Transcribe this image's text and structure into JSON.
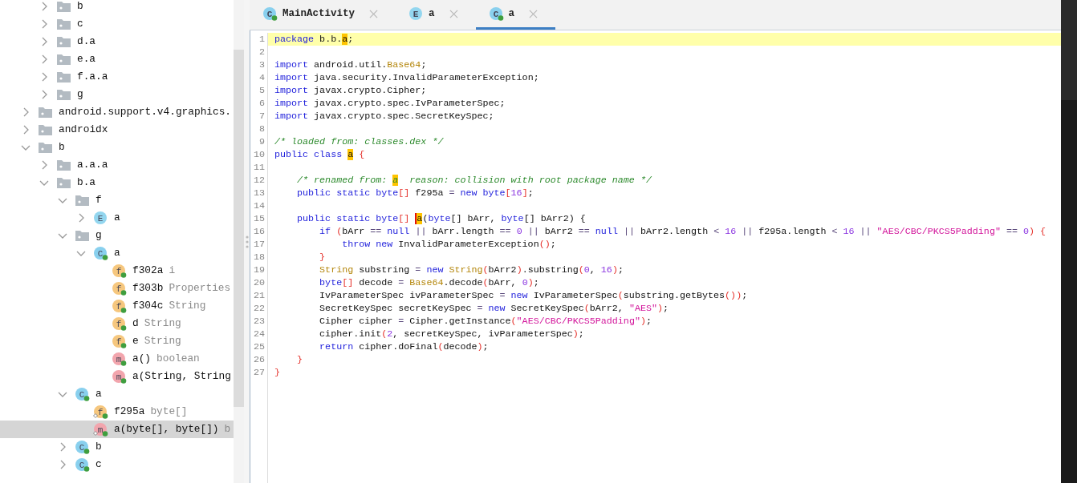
{
  "tree": [
    {
      "children": [
        {
          "label": "b",
          "kind": "package",
          "expanded": false,
          "selected": false
        },
        {
          "label": "c",
          "kind": "package",
          "expanded": false,
          "selected": false
        },
        {
          "label": "d.a",
          "kind": "package",
          "expanded": false,
          "selected": false
        },
        {
          "label": "e.a",
          "kind": "package",
          "expanded": false,
          "selected": false
        },
        {
          "label": "f.a.a",
          "kind": "package",
          "expanded": false,
          "selected": false
        },
        {
          "label": "g",
          "kind": "package",
          "expanded": false,
          "selected": false
        }
      ]
    },
    {
      "label": "android.support.v4.graphics.",
      "kind": "package",
      "expanded": false,
      "selected": false
    },
    {
      "label": "androidx",
      "kind": "package",
      "expanded": false,
      "selected": false
    },
    {
      "label": "b",
      "kind": "package",
      "expanded": true,
      "selected": false,
      "children": [
        {
          "label": "a.a.a",
          "kind": "package",
          "expanded": false,
          "selected": false
        },
        {
          "label": "b.a",
          "kind": "package",
          "expanded": true,
          "selected": false,
          "children": [
            {
              "label": "f",
              "kind": "package",
              "expanded": true,
              "selected": false,
              "children": [
                {
                  "label": "a",
                  "kind": "enum",
                  "icon": "E",
                  "public": false,
                  "expanded": false,
                  "selected": false
                }
              ]
            },
            {
              "label": "g",
              "kind": "package",
              "expanded": true,
              "selected": false,
              "children": [
                {
                  "label": "a",
                  "kind": "class",
                  "icon": "C",
                  "public": true,
                  "expanded": true,
                  "selected": false,
                  "children": [
                    {
                      "label": "f302a",
                      "detail": "i",
                      "kind": "field",
                      "icon": "f",
                      "public": true,
                      "static": false,
                      "selected": false
                    },
                    {
                      "label": "f303b",
                      "detail": "Properties",
                      "kind": "field",
                      "icon": "f",
                      "public": true,
                      "static": false,
                      "selected": false
                    },
                    {
                      "label": "f304c",
                      "detail": "String",
                      "kind": "field",
                      "icon": "f",
                      "public": true,
                      "static": false,
                      "selected": false
                    },
                    {
                      "label": "d",
                      "detail": "String",
                      "kind": "field",
                      "icon": "f",
                      "public": true,
                      "static": false,
                      "selected": false
                    },
                    {
                      "label": "e",
                      "detail": "String",
                      "kind": "field",
                      "icon": "f",
                      "public": true,
                      "static": false,
                      "selected": false
                    },
                    {
                      "label": "a()",
                      "detail": "boolean",
                      "kind": "method",
                      "icon": "m",
                      "public": true,
                      "static": false,
                      "selected": false
                    },
                    {
                      "label": "a(String, String",
                      "kind": "method",
                      "icon": "m",
                      "public": true,
                      "static": false,
                      "selected": false
                    }
                  ]
                }
              ]
            },
            {
              "label": "a",
              "kind": "class",
              "icon": "C",
              "public": true,
              "expanded": true,
              "selected": false,
              "children": [
                {
                  "label": "f295a",
                  "detail": "byte[]",
                  "kind": "field",
                  "icon": "f",
                  "public": true,
                  "static": true,
                  "selected": false
                },
                {
                  "label": "a(byte[], byte[])",
                  "detail": "b",
                  "kind": "method",
                  "icon": "m",
                  "public": true,
                  "static": true,
                  "selected": true
                }
              ]
            },
            {
              "label": "b",
              "kind": "class",
              "icon": "C",
              "public": true,
              "expanded": false,
              "selected": false
            },
            {
              "label": "c",
              "kind": "class",
              "icon": "C",
              "public": true,
              "expanded": false,
              "selected": false
            }
          ]
        }
      ]
    }
  ],
  "tabs": [
    {
      "label": "MainActivity",
      "icon": "C",
      "kind": "class",
      "public": true,
      "selected": false
    },
    {
      "label": "a",
      "icon": "E",
      "kind": "enum",
      "public": false,
      "selected": false
    },
    {
      "label": "a",
      "icon": "C",
      "kind": "class",
      "public": true,
      "selected": true
    }
  ],
  "code": [
    {
      "number": "1",
      "highlighted": true,
      "tokens": [
        {
          "kind": "kw",
          "text": "package"
        },
        {
          "kind": "plain",
          "text": " b.b."
        },
        {
          "kind": "match",
          "text": "a"
        },
        {
          "kind": "plain",
          "text": ";"
        }
      ]
    },
    {
      "number": "2",
      "highlighted": false
    },
    {
      "number": "3",
      "highlighted": false,
      "tokens": [
        {
          "kind": "kw",
          "text": "import"
        },
        {
          "kind": "plain",
          "text": " android.util."
        },
        {
          "kind": "type",
          "text": "Base64"
        },
        {
          "kind": "plain",
          "text": ";"
        }
      ]
    },
    {
      "number": "4",
      "highlighted": false,
      "tokens": [
        {
          "kind": "kw",
          "text": "import"
        },
        {
          "kind": "plain",
          "text": " java.security.InvalidParameterException;"
        }
      ]
    },
    {
      "number": "5",
      "highlighted": false,
      "tokens": [
        {
          "kind": "kw",
          "text": "import"
        },
        {
          "kind": "plain",
          "text": " javax.crypto.Cipher;"
        }
      ]
    },
    {
      "number": "6",
      "highlighted": false,
      "tokens": [
        {
          "kind": "kw",
          "text": "import"
        },
        {
          "kind": "plain",
          "text": " javax.crypto.spec.IvParameterSpec;"
        }
      ]
    },
    {
      "number": "7",
      "highlighted": false,
      "tokens": [
        {
          "kind": "kw",
          "text": "import"
        },
        {
          "kind": "plain",
          "text": " javax.crypto.spec.SecretKeySpec;"
        }
      ]
    },
    {
      "number": "8",
      "highlighted": false
    },
    {
      "number": "9",
      "highlighted": false,
      "tokens": [
        {
          "kind": "comment",
          "text": "/* loaded from: classes.dex */"
        }
      ]
    },
    {
      "number": "10",
      "highlighted": false,
      "tokens": [
        {
          "kind": "kw",
          "text": "public class "
        },
        {
          "kind": "match",
          "text": "a"
        },
        {
          "kind": "paren",
          "text": " {"
        }
      ]
    },
    {
      "number": "11",
      "highlighted": false
    },
    {
      "number": "12",
      "highlighted": false,
      "tokens": [
        {
          "kind": "comment",
          "text": "    /* renamed from: "
        },
        {
          "kind": "comment-match",
          "text": "a"
        },
        {
          "kind": "comment",
          "text": "  reason: collision with root package name */"
        }
      ]
    },
    {
      "number": "13",
      "highlighted": false,
      "tokens": [
        {
          "kind": "kw",
          "text": "    public static byte"
        },
        {
          "kind": "paren",
          "text": "[]"
        },
        {
          "kind": "plain",
          "text": " f295a "
        },
        {
          "kind": "op",
          "text": "="
        },
        {
          "kind": "kw",
          "text": " new byte"
        },
        {
          "kind": "paren",
          "text": "["
        },
        {
          "kind": "num",
          "text": "16"
        },
        {
          "kind": "paren",
          "text": "]"
        },
        {
          "kind": "plain",
          "text": ";"
        }
      ]
    },
    {
      "number": "14",
      "highlighted": false
    },
    {
      "number": "15",
      "highlighted": false,
      "tokens": [
        {
          "kind": "kw",
          "text": "    public static byte"
        },
        {
          "kind": "paren",
          "text": "[] "
        },
        {
          "kind": "caret-match",
          "text": "a"
        },
        {
          "kind": "plain",
          "text": "("
        },
        {
          "kind": "kw",
          "text": "byte"
        },
        {
          "kind": "plain",
          "text": "[] bArr, "
        },
        {
          "kind": "kw",
          "text": "byte"
        },
        {
          "kind": "plain",
          "text": "[] bArr2) {"
        }
      ]
    },
    {
      "number": "16",
      "highlighted": false,
      "tokens": [
        {
          "kind": "kw",
          "text": "        if "
        },
        {
          "kind": "paren",
          "text": "("
        },
        {
          "kind": "plain",
          "text": "bArr "
        },
        {
          "kind": "op",
          "text": "=="
        },
        {
          "kind": "kw",
          "text": " null "
        },
        {
          "kind": "op",
          "text": "||"
        },
        {
          "kind": "plain",
          "text": " bArr.length "
        },
        {
          "kind": "op",
          "text": "=="
        },
        {
          "kind": "num",
          "text": " 0 "
        },
        {
          "kind": "op",
          "text": "||"
        },
        {
          "kind": "plain",
          "text": " bArr2 "
        },
        {
          "kind": "op",
          "text": "=="
        },
        {
          "kind": "kw",
          "text": " null "
        },
        {
          "kind": "op",
          "text": "||"
        },
        {
          "kind": "plain",
          "text": " bArr2.length "
        },
        {
          "kind": "op",
          "text": "<"
        },
        {
          "kind": "num",
          "text": " 16 "
        },
        {
          "kind": "op",
          "text": "||"
        },
        {
          "kind": "plain",
          "text": " f295a.length "
        },
        {
          "kind": "op",
          "text": "<"
        },
        {
          "kind": "num",
          "text": " 16 "
        },
        {
          "kind": "op",
          "text": "||"
        },
        {
          "kind": "str",
          "text": " \"AES/CBC/PKCS5Padding\" "
        },
        {
          "kind": "op",
          "text": "=="
        },
        {
          "kind": "num",
          "text": " 0"
        },
        {
          "kind": "paren",
          "text": ") {"
        }
      ]
    },
    {
      "number": "17",
      "highlighted": false,
      "tokens": [
        {
          "kind": "kw",
          "text": "            throw new"
        },
        {
          "kind": "plain",
          "text": " InvalidParameterException"
        },
        {
          "kind": "paren",
          "text": "()"
        },
        {
          "kind": "plain",
          "text": ";"
        }
      ]
    },
    {
      "number": "18",
      "highlighted": false,
      "tokens": [
        {
          "kind": "paren",
          "text": "        }"
        }
      ]
    },
    {
      "number": "19",
      "highlighted": false,
      "tokens": [
        {
          "kind": "type",
          "text": "        String"
        },
        {
          "kind": "plain",
          "text": " substring "
        },
        {
          "kind": "op",
          "text": "="
        },
        {
          "kind": "kw",
          "text": " new "
        },
        {
          "kind": "type",
          "text": "String"
        },
        {
          "kind": "paren",
          "text": "("
        },
        {
          "kind": "plain",
          "text": "bArr2"
        },
        {
          "kind": "paren",
          "text": ")"
        },
        {
          "kind": "plain",
          "text": ".substring"
        },
        {
          "kind": "paren",
          "text": "("
        },
        {
          "kind": "num",
          "text": "0"
        },
        {
          "kind": "plain",
          "text": ", "
        },
        {
          "kind": "num",
          "text": "16"
        },
        {
          "kind": "paren",
          "text": ")"
        },
        {
          "kind": "plain",
          "text": ";"
        }
      ]
    },
    {
      "number": "20",
      "highlighted": false,
      "tokens": [
        {
          "kind": "kw",
          "text": "        byte"
        },
        {
          "kind": "paren",
          "text": "[]"
        },
        {
          "kind": "plain",
          "text": " decode "
        },
        {
          "kind": "op",
          "text": "="
        },
        {
          "kind": "type",
          "text": " Base64"
        },
        {
          "kind": "plain",
          "text": ".decode"
        },
        {
          "kind": "paren",
          "text": "("
        },
        {
          "kind": "plain",
          "text": "bArr, "
        },
        {
          "kind": "num",
          "text": "0"
        },
        {
          "kind": "paren",
          "text": ")"
        },
        {
          "kind": "plain",
          "text": ";"
        }
      ]
    },
    {
      "number": "21",
      "highlighted": false,
      "tokens": [
        {
          "kind": "plain",
          "text": "        IvParameterSpec ivParameterSpec "
        },
        {
          "kind": "op",
          "text": "="
        },
        {
          "kind": "kw",
          "text": " new"
        },
        {
          "kind": "plain",
          "text": " IvParameterSpec"
        },
        {
          "kind": "paren",
          "text": "("
        },
        {
          "kind": "plain",
          "text": "substring.getBytes"
        },
        {
          "kind": "paren",
          "text": "())"
        },
        {
          "kind": "plain",
          "text": ";"
        }
      ]
    },
    {
      "number": "22",
      "highlighted": false,
      "tokens": [
        {
          "kind": "plain",
          "text": "        SecretKeySpec secretKeySpec "
        },
        {
          "kind": "op",
          "text": "="
        },
        {
          "kind": "kw",
          "text": " new"
        },
        {
          "kind": "plain",
          "text": " SecretKeySpec"
        },
        {
          "kind": "paren",
          "text": "("
        },
        {
          "kind": "plain",
          "text": "bArr2, "
        },
        {
          "kind": "str",
          "text": "\"AES\""
        },
        {
          "kind": "paren",
          "text": ")"
        },
        {
          "kind": "plain",
          "text": ";"
        }
      ]
    },
    {
      "number": "23",
      "highlighted": false,
      "tokens": [
        {
          "kind": "plain",
          "text": "        Cipher cipher "
        },
        {
          "kind": "op",
          "text": "="
        },
        {
          "kind": "plain",
          "text": " Cipher.getInstance"
        },
        {
          "kind": "paren",
          "text": "("
        },
        {
          "kind": "str",
          "text": "\"AES/CBC/PKCS5Padding\""
        },
        {
          "kind": "paren",
          "text": ")"
        },
        {
          "kind": "plain",
          "text": ";"
        }
      ]
    },
    {
      "number": "24",
      "highlighted": false,
      "tokens": [
        {
          "kind": "plain",
          "text": "        cipher.init"
        },
        {
          "kind": "paren",
          "text": "("
        },
        {
          "kind": "num",
          "text": "2"
        },
        {
          "kind": "plain",
          "text": ", secretKeySpec, ivParameterSpec"
        },
        {
          "kind": "paren",
          "text": ")"
        },
        {
          "kind": "plain",
          "text": ";"
        }
      ]
    },
    {
      "number": "25",
      "highlighted": false,
      "tokens": [
        {
          "kind": "kw",
          "text": "        return"
        },
        {
          "kind": "plain",
          "text": " cipher.doFinal"
        },
        {
          "kind": "paren",
          "text": "("
        },
        {
          "kind": "plain",
          "text": "decode"
        },
        {
          "kind": "paren",
          "text": ")"
        },
        {
          "kind": "plain",
          "text": ";"
        }
      ]
    },
    {
      "number": "26",
      "highlighted": false,
      "tokens": [
        {
          "kind": "paren",
          "text": "    }"
        }
      ]
    },
    {
      "number": "27",
      "highlighted": false,
      "tokens": [
        {
          "kind": "paren",
          "text": "}"
        }
      ]
    }
  ]
}
